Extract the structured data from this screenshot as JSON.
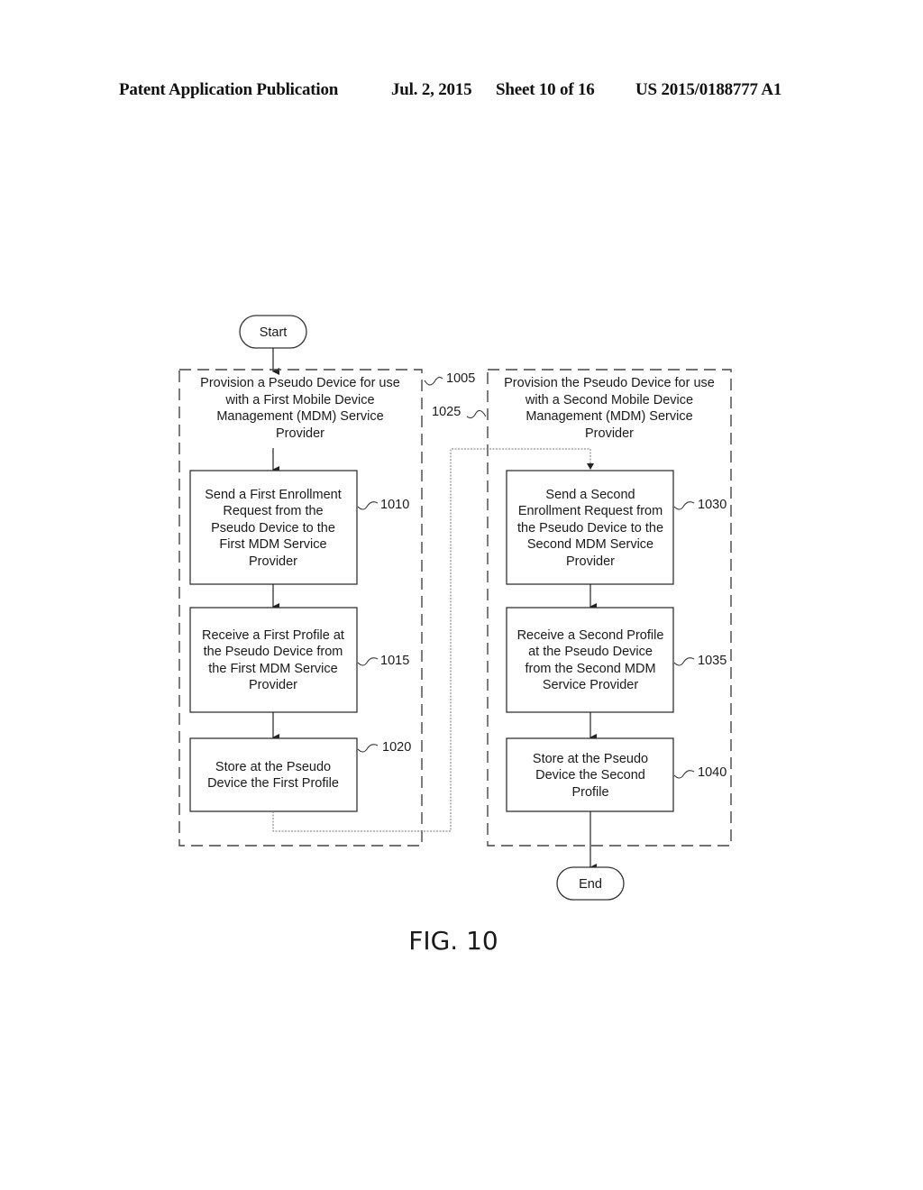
{
  "header": {
    "publication": "Patent Application Publication",
    "date": "Jul. 2, 2015",
    "sheet": "Sheet 10 of 16",
    "patent_number": "US 2015/0188777 A1"
  },
  "figure_label": "FIG. 10",
  "terminals": {
    "start": "Start",
    "end": "End"
  },
  "groups": [
    {
      "ref": "1005",
      "title_lines": [
        "Provision a Pseudo Device for use",
        "with a First Mobile Device",
        "Management (MDM) Service",
        "Provider"
      ]
    },
    {
      "ref": "1025",
      "title_lines": [
        "Provision the Pseudo Device for use",
        "with a Second Mobile Device",
        "Management (MDM) Service",
        "Provider"
      ]
    }
  ],
  "steps": [
    {
      "ref": "1010",
      "lines": [
        "Send a First Enrollment",
        "Request from the",
        "Pseudo Device to the",
        "First MDM Service",
        "Provider"
      ]
    },
    {
      "ref": "1015",
      "lines": [
        "Receive a First Profile at",
        "the Pseudo Device from",
        "the First MDM Service",
        "Provider"
      ]
    },
    {
      "ref": "1020",
      "lines": [
        "Store at the Pseudo",
        "Device the First Profile"
      ]
    },
    {
      "ref": "1030",
      "lines": [
        "Send a Second",
        "Enrollment Request from",
        "the Pseudo Device to the",
        "Second MDM Service",
        "Provider"
      ]
    },
    {
      "ref": "1035",
      "lines": [
        "Receive a Second Profile",
        "at the Pseudo Device",
        "from the Second MDM",
        "Service Provider"
      ]
    },
    {
      "ref": "1040",
      "lines": [
        "Store at the Pseudo",
        "Device the Second",
        "Profile"
      ]
    }
  ]
}
